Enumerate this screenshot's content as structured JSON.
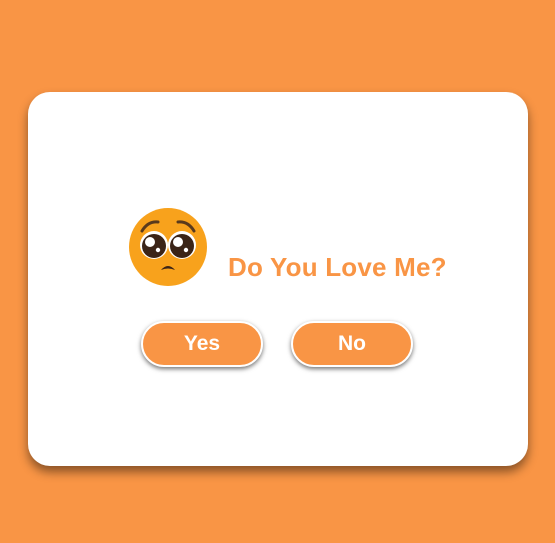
{
  "dialog": {
    "question": "Do You Love Me?",
    "emoji": "pleading-face-icon"
  },
  "buttons": {
    "yes_label": "Yes",
    "no_label": "No"
  },
  "colors": {
    "background": "#F99545",
    "card": "#FFFFFF",
    "accent": "#F99545",
    "emoji_face": "#F8A21C"
  }
}
